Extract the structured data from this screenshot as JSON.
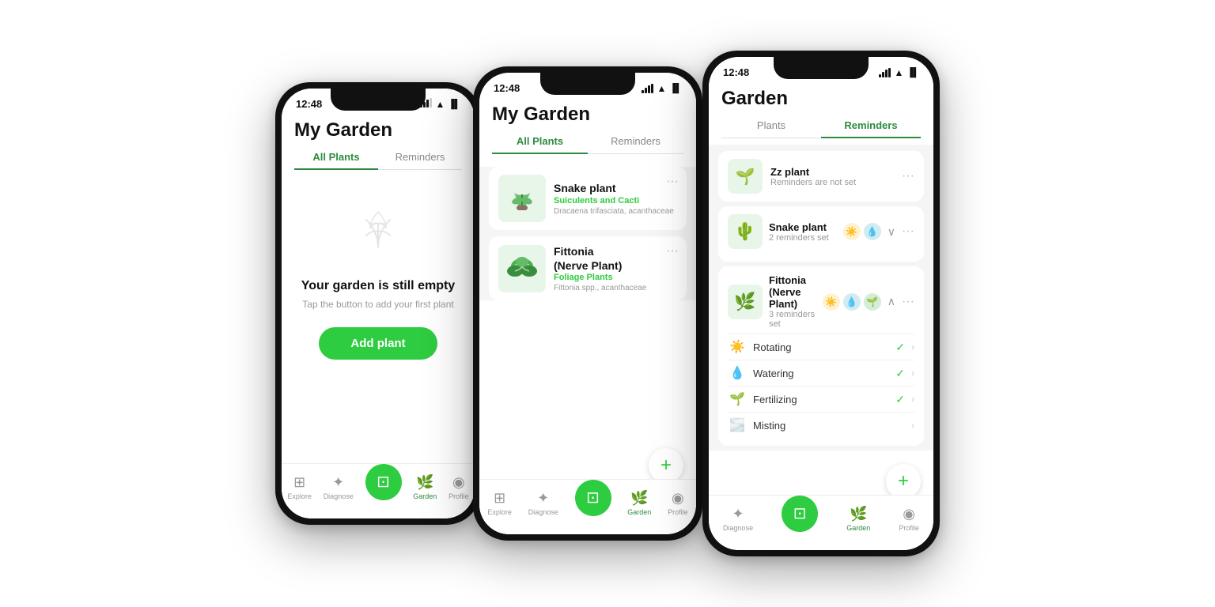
{
  "scene": {
    "background": "#ffffff"
  },
  "phone_left": {
    "status": {
      "time": "12:48",
      "signal": "●●●",
      "wifi": "WiFi",
      "battery": "🔋"
    },
    "title": "My Garden",
    "tabs": [
      "All Plants",
      "Reminders"
    ],
    "active_tab": 0,
    "empty": {
      "icon": "🌿",
      "title": "Your garden is still empty",
      "subtitle": "Tap the button to add your first plant",
      "button": "Add plant"
    },
    "nav": [
      "Explore",
      "Diagnose",
      "Scan",
      "Garden",
      "Profile"
    ]
  },
  "phone_center": {
    "status": {
      "time": "12:48"
    },
    "title": "My Garden",
    "tabs": [
      "All Plants",
      "Reminders"
    ],
    "active_tab": 0,
    "plants": [
      {
        "name": "Snake plant",
        "category": "Suiculents and Cacti",
        "latin": "Dracaena trifasciata, acanthaceae",
        "emoji": "🌵"
      },
      {
        "name": "Fittonia\n(Nerve Plant)",
        "category": "Foliage Plants",
        "latin": "Fittonia spp., acanthaceae",
        "emoji": "🌿"
      }
    ],
    "nav": [
      "Explore",
      "Diagnose",
      "Scan",
      "Garden",
      "Profile"
    ]
  },
  "phone_right": {
    "status": {
      "time": "12:48"
    },
    "title": "Garden",
    "tabs": [
      "Plants",
      "Reminders"
    ],
    "active_tab": 1,
    "zz_plant": {
      "name": "Zz plant",
      "subtitle": "Reminders are not set",
      "emoji": "🌱"
    },
    "snake_plant": {
      "name": "Snake plant",
      "subtitle": "2 reminders set",
      "emoji": "🌵",
      "expanded": false,
      "badges": [
        "☀️",
        "💧"
      ]
    },
    "fittonia": {
      "name": "Fittonia\n(Nerve Plant)",
      "subtitle": "3 reminders set",
      "emoji": "🌿",
      "expanded": true,
      "badges": [
        "☀️",
        "💧",
        "🌱"
      ],
      "reminders": [
        {
          "icon": "☀️",
          "label": "Rotating",
          "checked": true
        },
        {
          "icon": "💧",
          "label": "Watering",
          "checked": true
        },
        {
          "icon": "🌱",
          "label": "Fertilizing",
          "checked": true
        },
        {
          "icon": "🌫️",
          "label": "Misting",
          "checked": false
        }
      ]
    },
    "nav": [
      "Diagnose",
      "Scan",
      "Garden",
      "Profile"
    ]
  }
}
